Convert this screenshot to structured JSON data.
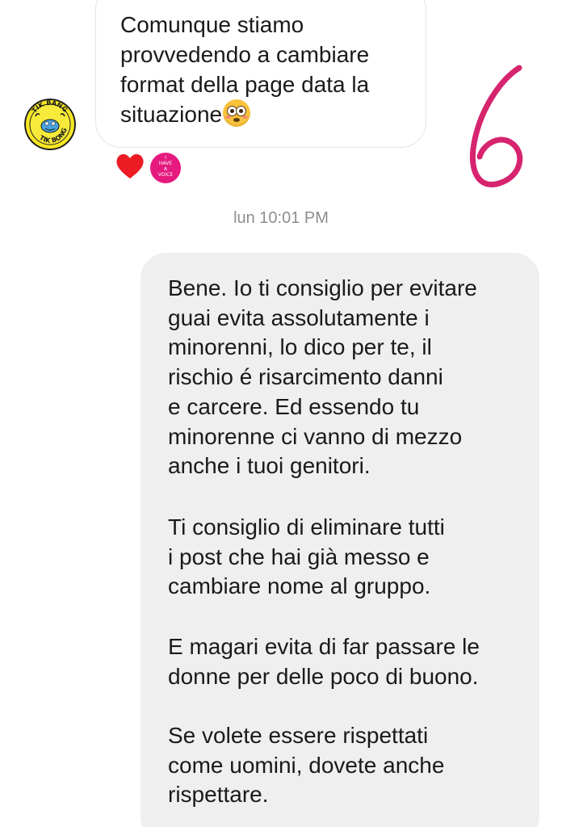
{
  "incoming": {
    "message": "Comunque stiamo\nprovvedendo a cambiare\nformat della page data la\nsituazione",
    "emoji": "flushed-face-emoji",
    "reactions": [
      {
        "icon": "red-heart-icon"
      },
      {
        "icon": "i-have-a-voice-sticker",
        "text": "I\nHAVE\nA\nVOICE"
      }
    ],
    "avatar": {
      "icon": "tik-bang-avatar-logo",
      "logo_text": "TIK BANG TIK BONG"
    }
  },
  "annotation": {
    "text": "6",
    "color": "#d6246e"
  },
  "timestamp": "lun 10:01 PM",
  "outgoing": {
    "paragraphs": [
      "Bene. Io ti consiglio per evitare\nguai evita assolutamente i\nminorenni, lo dico per te, il\nrischio é risarcimento danni\ne carcere. Ed essendo tu\nminorenne ci vanno di mezzo\nanche i tuoi genitori.",
      "Ti consiglio di eliminare tutti\ni post che hai già messo e\ncambiare nome al gruppo.",
      "E magari evita di far passare le\ndonne per delle poco di buono.",
      "Se volete essere rispettati\ncome uomini, dovete anche\nrispettare."
    ]
  },
  "colors": {
    "incoming_bubble_border": "#e4e4e4",
    "outgoing_bubble_bg": "#efefef",
    "timestamp": "#8e8e8e",
    "heart": "#ed1c24",
    "sticker": "#e5197e"
  }
}
